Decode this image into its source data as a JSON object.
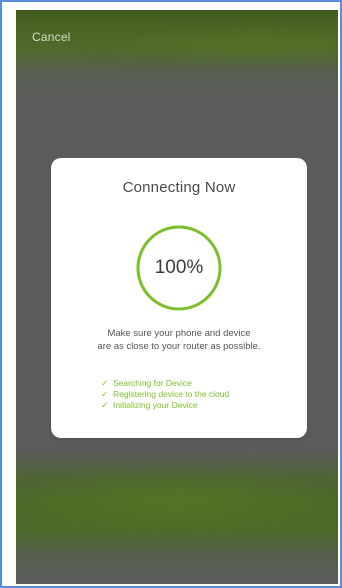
{
  "header": {
    "cancel_label": "Cancel"
  },
  "dialog": {
    "title": "Connecting Now",
    "progress": {
      "value": 1.0,
      "label": "100%"
    },
    "hint_line1": "Make sure your phone and device",
    "hint_line2": "are as close to your router as possible.",
    "steps": [
      {
        "icon": "check-icon",
        "label": "Searching for Device"
      },
      {
        "icon": "check-icon",
        "label": "Registering device to the cloud"
      },
      {
        "icon": "check-icon",
        "label": "Initializing your Device"
      }
    ]
  },
  "colors": {
    "accent": "#7cc12a",
    "frame": "#5b8ed6",
    "overlay": "#5b5b5b"
  }
}
